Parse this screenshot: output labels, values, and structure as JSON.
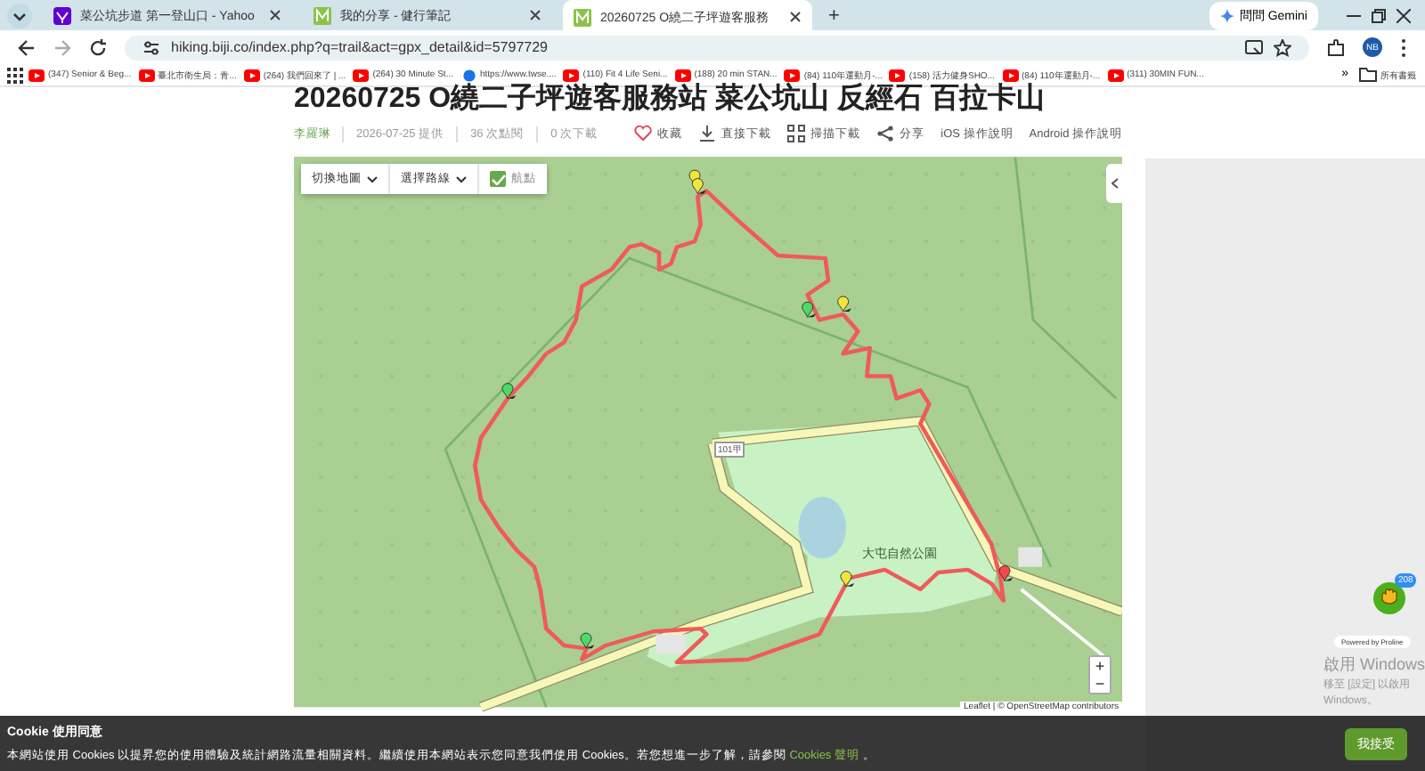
{
  "browser": {
    "tabs": [
      {
        "title": "菜公坑步道 第一登山口 - Yahoo",
        "selected": false,
        "kind": "yahoo"
      },
      {
        "title": "我的分享 - 健行筆記",
        "selected": false,
        "kind": "site"
      },
      {
        "title": "20260725 O繞二子坪遊客服務",
        "selected": true,
        "kind": "site"
      }
    ],
    "new_tab": "+",
    "gemini": "問問 Gemini",
    "address": "hiking.biji.co/index.php?q=trail&act=gpx_detail&id=5797729",
    "profile": "NB",
    "bookmarks": [
      "(347) Senior & Beg...",
      "臺北市衛生局：青...",
      "(264) 我們回來了 | ...",
      "(264) 30 Minute St...",
      "https://www.twse....",
      "(110) Fit 4 Life Seni...",
      "(188) 20 min STAN...",
      "(84) 110年運動月-...",
      "(158) 活力健身SHO...",
      "(84) 110年運動月-...",
      "(311) 30MIN FUN..."
    ],
    "more": "»",
    "all_bookmarks": "所有書籤"
  },
  "page": {
    "title": "20260725 O繞二子坪遊客服務站 菜公坑山 反經石 百拉卡山",
    "author": "李羅琳",
    "meta": [
      "2026-07-25 提供",
      "36 次點閱",
      "0 次下載"
    ],
    "actions": [
      {
        "label": "收藏",
        "kind": "heart"
      },
      {
        "label": "直接下載",
        "kind": "download"
      },
      {
        "label": "掃描下載",
        "kind": "qr"
      },
      {
        "label": "分享",
        "kind": "share"
      },
      {
        "label": "iOS 操作說明",
        "kind": "text"
      },
      {
        "label": "Android 操作說明",
        "kind": "text"
      }
    ],
    "map": {
      "switch_map": "切換地圖",
      "select_route": "選擇路線",
      "waypoints": {
        "label": "航點",
        "checked": true
      },
      "labels": [
        "101甲",
        "大屯自然公園"
      ],
      "zoom_in": "+",
      "zoom_out": "−",
      "attribution": "Leaflet | © OpenStreetMap contributors"
    }
  },
  "chat": {
    "badge": "208",
    "powered": "Powered by Proline"
  },
  "activation": {
    "title": "啟用 Windows",
    "text": "移至 [設定] 以啟用 Windows。"
  },
  "cookie": {
    "title": "Cookie 使用同意",
    "text": "本網站使用 Cookies 以提昇您的使用體驗及統計網路流量相關資料。繼續使用本網站表示您同意我們使用 Cookies。若您想進一步了解，請參閱",
    "link": "Cookies 聲明",
    "after": "。",
    "accept": "我接受"
  }
}
